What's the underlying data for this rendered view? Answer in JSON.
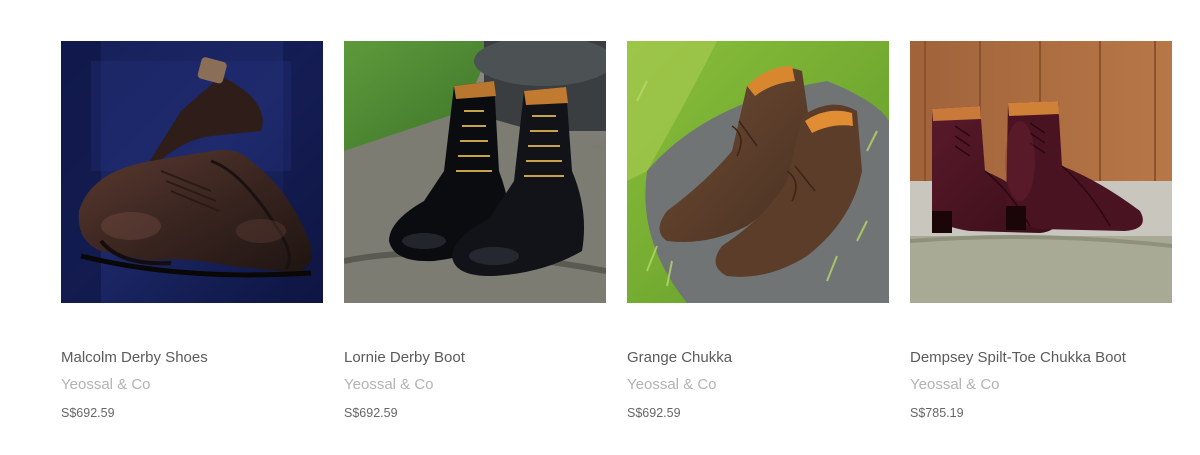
{
  "products": [
    {
      "title": "Malcolm Derby Shoes",
      "brand": "Yeossal & Co",
      "price": "S$692.59",
      "image_icon": "brown-derby-shoes-photo"
    },
    {
      "title": "Lornie Derby Boot",
      "brand": "Yeossal & Co",
      "price": "S$692.59",
      "image_icon": "black-derby-boots-photo"
    },
    {
      "title": "Grange Chukka",
      "brand": "Yeossal & Co",
      "price": "S$692.59",
      "image_icon": "suede-chukka-boots-photo"
    },
    {
      "title": "Dempsey Spilt-Toe Chukka Boot",
      "brand": "Yeossal & Co",
      "price": "S$785.19",
      "image_icon": "burgundy-chukka-boots-photo"
    }
  ],
  "colors": {
    "title_text": "#5b5b5b",
    "brand_text": "#b3b3b3",
    "price_text": "#666666",
    "background": "#ffffff"
  }
}
